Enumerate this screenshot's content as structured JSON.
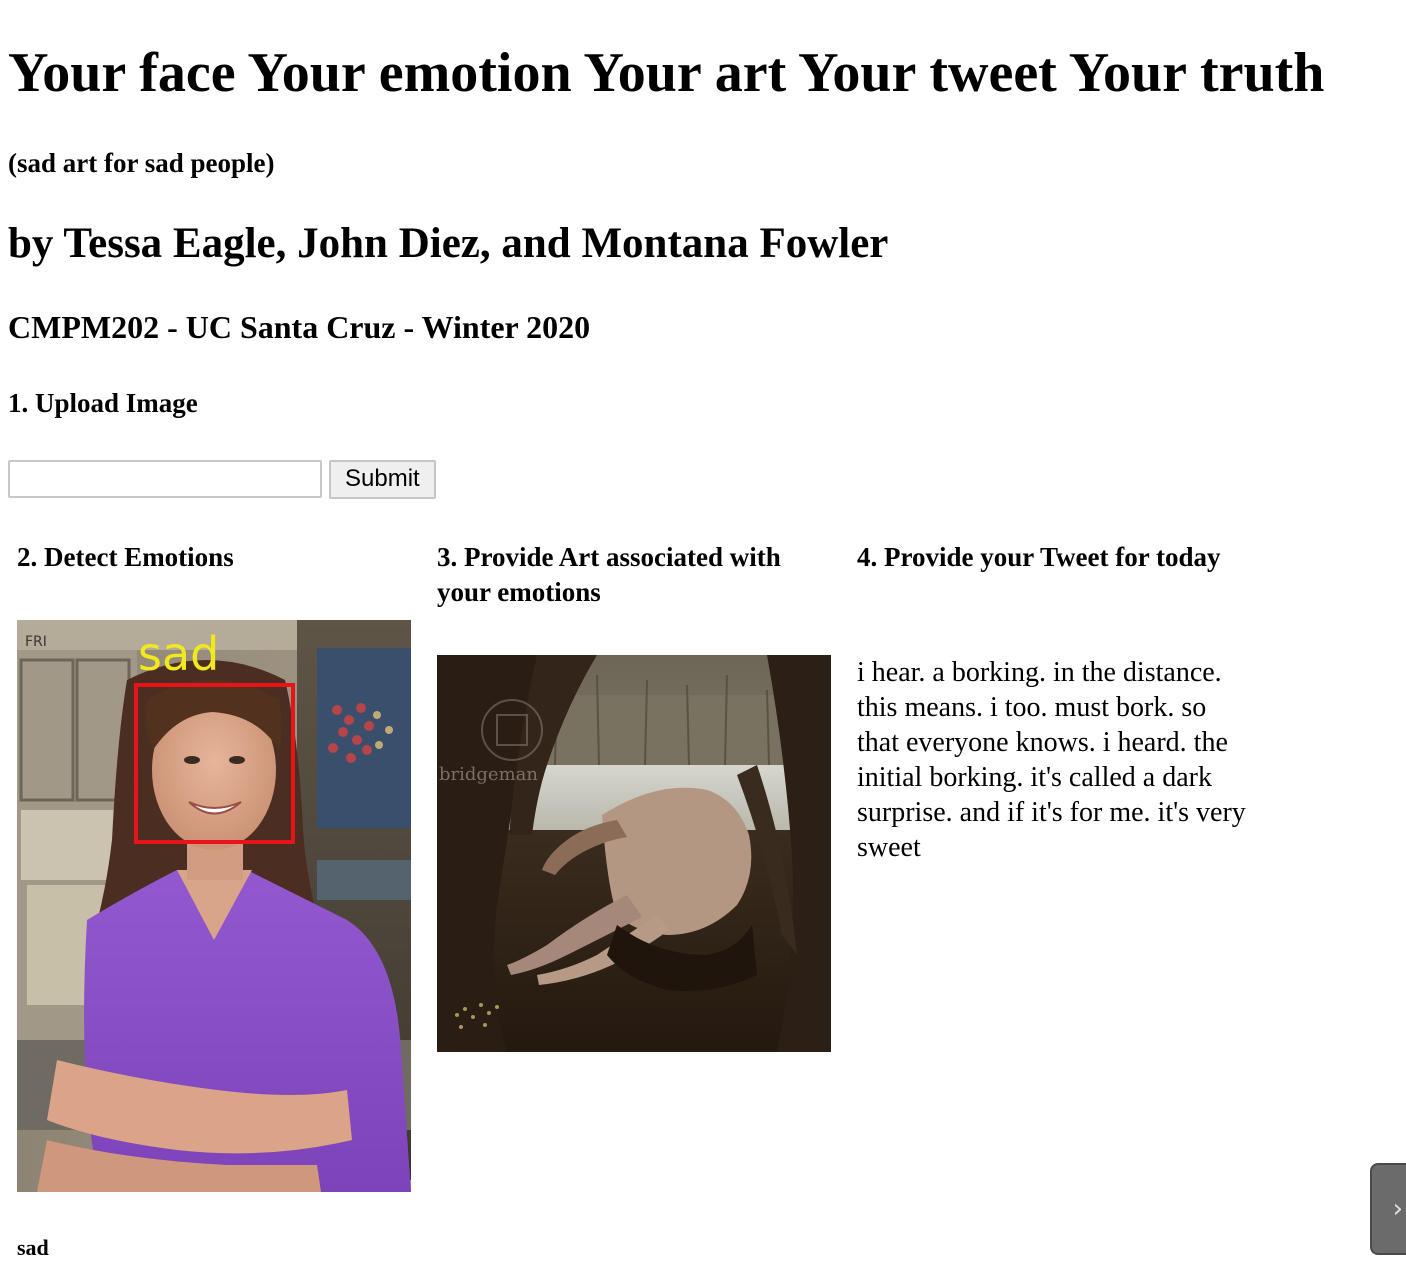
{
  "header": {
    "title": "Your face Your emotion Your art Your tweet Your truth",
    "subtitle": "(sad art for sad people)",
    "authors": "by Tessa Eagle, John Diez, and Montana Fowler",
    "course": "CMPM202 - UC Santa Cruz - Winter 2020"
  },
  "upload": {
    "heading": "1. Upload Image",
    "file_value": "",
    "submit_label": "Submit"
  },
  "detect": {
    "heading": "2. Detect Emotions",
    "overlay_label": "sad",
    "result_label": "sad"
  },
  "art": {
    "heading": "3. Provide Art associated with your emotions",
    "watermark": "bridgeman"
  },
  "tweet": {
    "heading": "4. Provide your Tweet for today",
    "text": "i hear. a borking. in the distance. this means. i too. must bork. so that everyone knows. i heard. the initial borking. it's called a dark surprise. and if it's for me. it's very sweet"
  },
  "side_tab": {
    "icon": "chevron-right-icon"
  },
  "colors": {
    "face_box": "#e8141a",
    "overlay_text": "#f2e81e",
    "shirt": "#8a4fc7"
  }
}
